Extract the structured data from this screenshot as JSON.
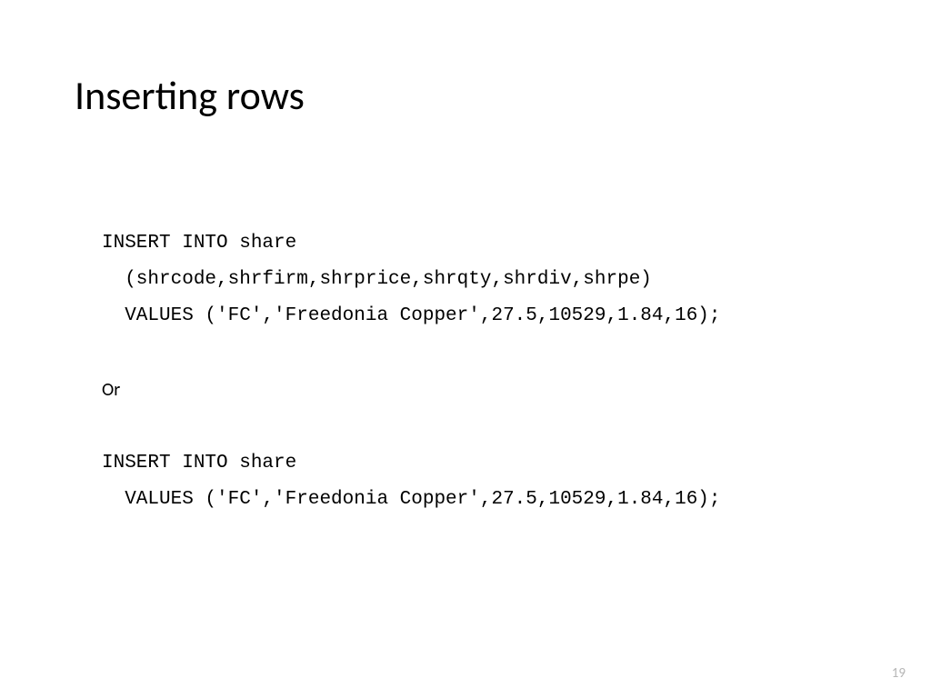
{
  "title": "Inserting rows",
  "code1_line1": "INSERT INTO share",
  "code1_line2": "  (shrcode,shrfirm,shrprice,shrqty,shrdiv,shrpe)",
  "code1_line3": "  VALUES ('FC','Freedonia Copper',27.5,10529,1.84,16);",
  "or": "Or",
  "code2_line1": "INSERT INTO share",
  "code2_line2": "  VALUES ('FC','Freedonia Copper',27.5,10529,1.84,16);",
  "page_number": "19"
}
